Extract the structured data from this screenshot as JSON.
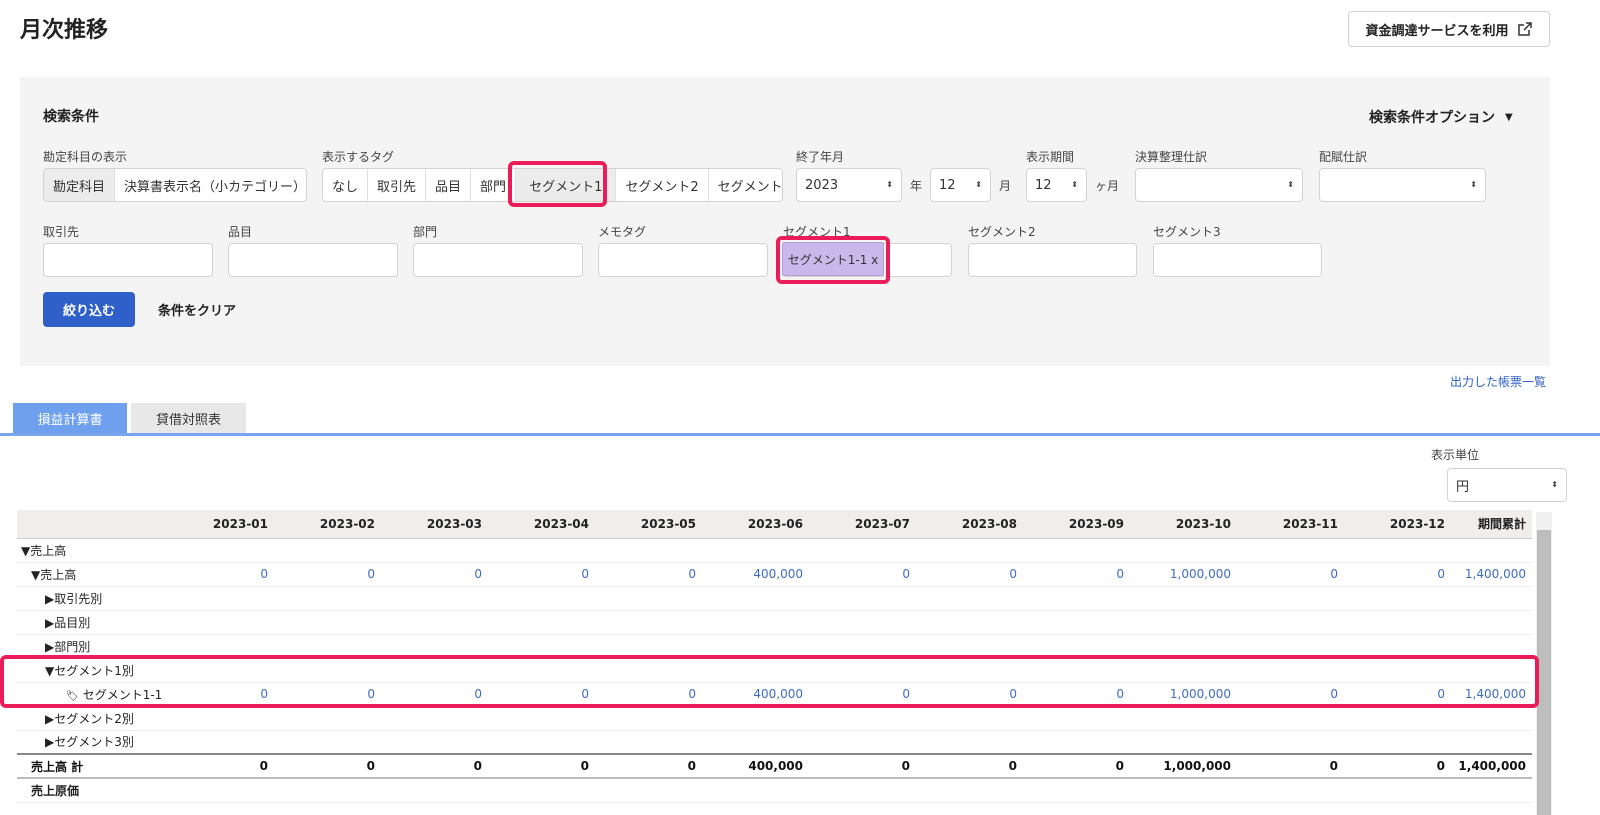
{
  "page": {
    "title": "月次推移",
    "funding_button": "資金調達サービスを利用"
  },
  "search": {
    "title": "検索条件",
    "options_toggle": "検索条件オプション",
    "account_display": {
      "label": "勘定科目の表示",
      "options": [
        "勘定科目",
        "決算書表示名（小カテゴリー）"
      ],
      "selected": 0
    },
    "tag_display": {
      "label": "表示するタグ",
      "options": [
        "なし",
        "取引先",
        "品目",
        "部門",
        "セグメント1",
        "セグメント2",
        "セグメント3"
      ],
      "selected": 4
    },
    "end_month": {
      "label": "終了年月",
      "year": "2023",
      "year_unit": "年",
      "month": "12",
      "month_unit": "月"
    },
    "period": {
      "label": "表示期間",
      "value": "12",
      "unit": "ヶ月"
    },
    "closing_entries": {
      "label": "決算整理仕訳",
      "value": ""
    },
    "allocation_entries": {
      "label": "配賦仕訳",
      "value": ""
    },
    "filters": [
      {
        "label": "取引先",
        "value": ""
      },
      {
        "label": "品目",
        "value": ""
      },
      {
        "label": "部門",
        "value": ""
      },
      {
        "label": "メモタグ",
        "value": ""
      },
      {
        "label": "セグメント1",
        "value": ""
      },
      {
        "label": "セグメント2",
        "value": ""
      },
      {
        "label": "セグメント3",
        "value": ""
      }
    ],
    "segment1_chip": "セグメント1-1 x",
    "apply_button": "絞り込む",
    "clear_button": "条件をクリア"
  },
  "output_link": "出力した帳票一覧",
  "tabs": [
    {
      "label": "損益計算書",
      "active": true
    },
    {
      "label": "貸借対照表",
      "active": false
    }
  ],
  "display_unit": {
    "label": "表示単位",
    "value": "円"
  },
  "table": {
    "columns": [
      "",
      "2023-01",
      "2023-02",
      "2023-03",
      "2023-04",
      "2023-05",
      "2023-06",
      "2023-07",
      "2023-08",
      "2023-09",
      "2023-10",
      "2023-11",
      "2023-12",
      "期間累計"
    ],
    "rows": [
      {
        "name": "▼売上高",
        "values": [],
        "indent": 0,
        "kind": "group"
      },
      {
        "name": "▼売上高",
        "values": [
          "0",
          "0",
          "0",
          "0",
          "0",
          "400,000",
          "0",
          "0",
          "0",
          "1,000,000",
          "0",
          "0",
          "1,400,000"
        ],
        "indent": 1,
        "kind": "data"
      },
      {
        "name": "▶取引先別",
        "values": [],
        "indent": 2,
        "kind": "group"
      },
      {
        "name": "▶品目別",
        "values": [],
        "indent": 2,
        "kind": "group"
      },
      {
        "name": "▶部門別",
        "values": [],
        "indent": 2,
        "kind": "group"
      },
      {
        "name": "▼セグメント1別",
        "values": [],
        "indent": 2,
        "kind": "group"
      },
      {
        "name": "セグメント1-1",
        "values": [
          "0",
          "0",
          "0",
          "0",
          "0",
          "400,000",
          "0",
          "0",
          "0",
          "1,000,000",
          "0",
          "0",
          "1,400,000"
        ],
        "indent": 3,
        "kind": "tag"
      },
      {
        "name": "▶セグメント2別",
        "values": [],
        "indent": 2,
        "kind": "group"
      },
      {
        "name": "▶セグメント3別",
        "values": [],
        "indent": 2,
        "kind": "group"
      },
      {
        "name": "売上高 計",
        "values": [
          "0",
          "0",
          "0",
          "0",
          "0",
          "400,000",
          "0",
          "0",
          "0",
          "1,000,000",
          "0",
          "0",
          "1,400,000"
        ],
        "indent": 1,
        "kind": "total"
      },
      {
        "name": "売上原価",
        "values": [],
        "indent": 1,
        "kind": "section"
      }
    ]
  },
  "colors": {
    "primary": "#2f5fc9",
    "highlight": "#ea1c5a",
    "tab_active": "#6ea0ee",
    "chip": "#cbb8ea",
    "link": "#3f6cc6"
  }
}
